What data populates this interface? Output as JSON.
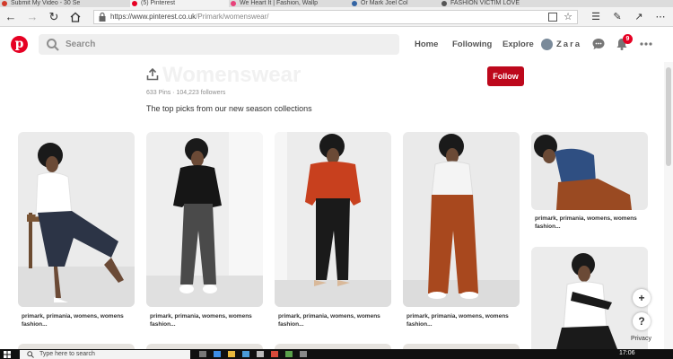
{
  "browser": {
    "tabs": [
      {
        "label": "Submit My Video - 30 Se",
        "fav_color": "#d23a2a"
      },
      {
        "label": "(5) Pinterest",
        "fav_color": "#e60023",
        "active": true
      },
      {
        "label": "We Heart It | Fashion, Wallp",
        "fav_color": "#e8427a"
      },
      {
        "label": "Or Mark Joel Col",
        "fav_color": "#3465a4"
      },
      {
        "label": "FASHION VICTIM LOVE",
        "fav_color": "#555555"
      }
    ],
    "url_prefix": "https://www.pinterest.co.uk",
    "url_path": "/Primark/womenswear/"
  },
  "header": {
    "search_placeholder": "Search",
    "nav": [
      "Home",
      "Following",
      "Explore"
    ],
    "username": "Zara",
    "notification_count": "9"
  },
  "board": {
    "title": "Womenswear",
    "stats": "633 Pins  ·  104,223 followers",
    "description": "The top picks from our new season collections",
    "follow_label": "Follow"
  },
  "pins": [
    {
      "caption": "primark, primania, womens, womens fashion...",
      "top_color": "#ffffff",
      "bottom_color": "#2c3446"
    },
    {
      "caption": "primark, primania, womens, womens fashion...",
      "top_color": "#161616",
      "bottom_color": "#4a4a4a"
    },
    {
      "caption": "primark, primania, womens, womens fashion...",
      "top_color": "#c8401e",
      "bottom_color": "#1a1a1a"
    },
    {
      "caption": "primark, primania, womens, womens fashion...",
      "top_color": "#f4f4f4",
      "bottom_color": "#a8481e"
    },
    {
      "caption": "primark, primania, womens, womens fashion...",
      "top_color": "#2f4f82",
      "bottom_color": "#9a4a22"
    }
  ],
  "floating": {
    "add_label": "+",
    "help_label": "?",
    "privacy_label": "Privacy"
  },
  "taskbar": {
    "search_placeholder": "Type here to search",
    "clock": "17:06"
  }
}
